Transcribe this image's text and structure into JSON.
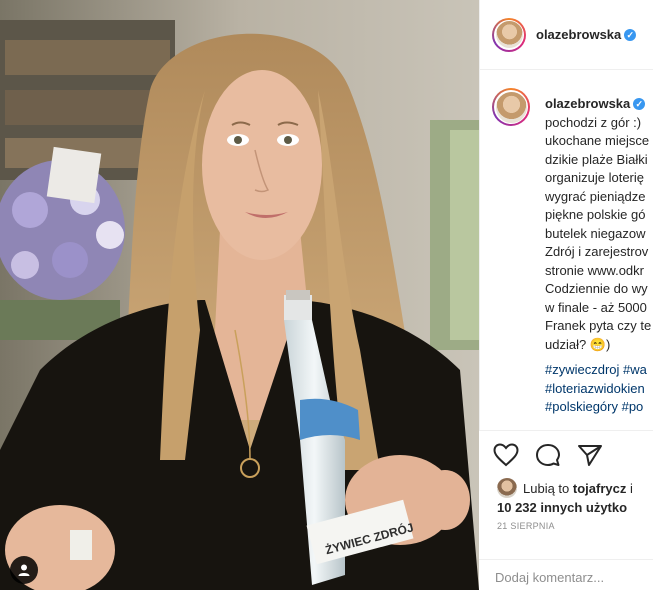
{
  "post": {
    "username": "olazebrowska",
    "verified_mark": "✓",
    "caption_lines": [
      "pochodzi z gór :)",
      "ukochane miejsce",
      "dzikie plaże Białki",
      "organizuje loterię",
      "wygrać pieniądze",
      "piękne polskie gó",
      "butelek niegazow",
      "Zdrój i zarejestrov",
      "stronie www.odkr",
      "Codziennie do wy",
      "w finale - aż 5000",
      "Franek pyta czy te",
      "udział? 😁)"
    ],
    "hashtags": [
      "#zywieczdroj #wa",
      "#loteriazwidokien",
      "#polskiegóry #po"
    ],
    "likes": {
      "prefix": "Lubią to",
      "user": "tojafrycz",
      "suffix": "i",
      "others": "10 232 innych użytko"
    },
    "date": "21 SIERPNIA",
    "comment_placeholder": "Dodaj komentarz..."
  },
  "photo": {
    "bottle_label": "ŻYWIEC ZDRÓJ",
    "icons": {
      "user_tag": "user-icon"
    }
  },
  "icons": {
    "like": "heart-icon",
    "comment": "comment-icon",
    "share": "share-icon",
    "verified": "verified-icon"
  },
  "colors": {
    "link": "#00376b",
    "verified": "#3897f0",
    "muted": "#8e8e8e"
  }
}
